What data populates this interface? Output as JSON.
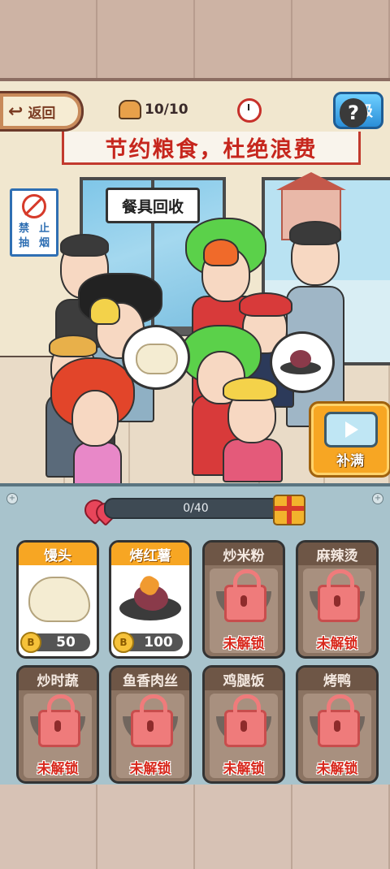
{
  "topbar": {
    "back_label": "返回",
    "back_arrow": "arrow-left-icon",
    "customer_count": "10/10",
    "upgrade_label": "升级"
  },
  "scene": {
    "banner": "节约粮食，杜绝浪费",
    "recycle_sign": "餐具回收",
    "no_smoking_sign": [
      "禁",
      "止",
      "抽",
      "烟"
    ],
    "help_label": "?",
    "refill_label": "补满"
  },
  "progress": {
    "text": "0/40",
    "value": 0,
    "max": 40
  },
  "dishes": [
    {
      "name": "馒头",
      "status": "unlocked",
      "price": "50",
      "coin_label": "B"
    },
    {
      "name": "烤红薯",
      "status": "unlocked",
      "price": "100",
      "coin_label": "B"
    },
    {
      "name": "炒米粉",
      "status": "locked",
      "lock_text": "未解锁"
    },
    {
      "name": "麻辣烫",
      "status": "locked",
      "lock_text": "未解锁"
    },
    {
      "name": "炒时蔬",
      "status": "locked",
      "lock_text": "未解锁"
    },
    {
      "name": "鱼香肉丝",
      "status": "locked",
      "lock_text": "未解锁"
    },
    {
      "name": "鸡腿饭",
      "status": "locked",
      "lock_text": "未解锁"
    },
    {
      "name": "烤鸭",
      "status": "locked",
      "lock_text": "未解锁"
    }
  ],
  "colors": {
    "accent_orange": "#f7a623",
    "lock_red": "#d8281c",
    "upgrade_blue": "#2a8ed8"
  }
}
